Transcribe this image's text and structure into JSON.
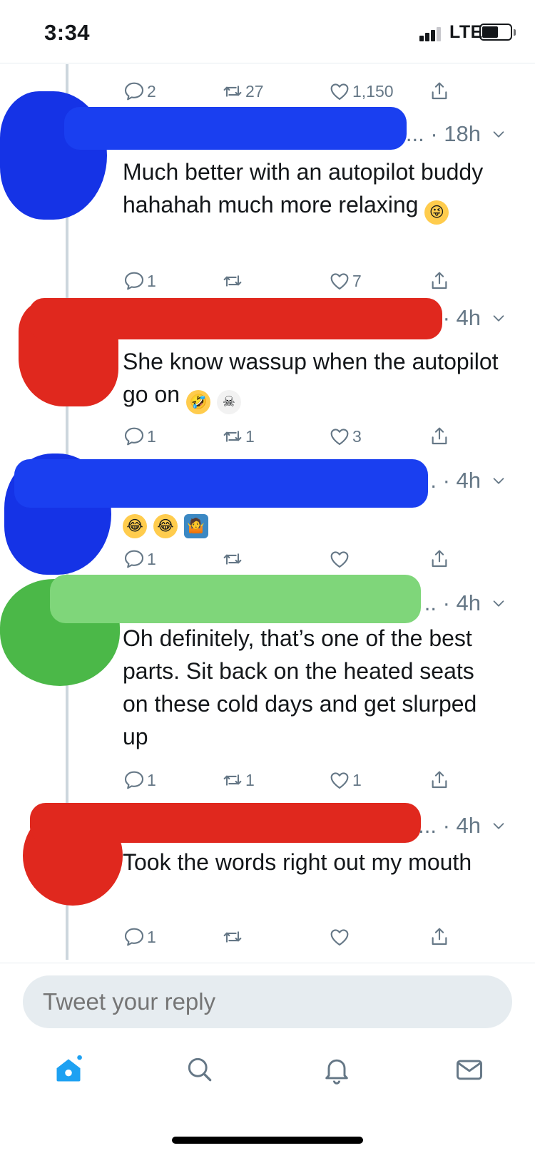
{
  "status_bar": {
    "time": "3:34",
    "network": "LTE"
  },
  "first_tweet_actions": {
    "replies": "2",
    "retweets": "27",
    "likes": "1,150"
  },
  "replies": [
    {
      "meta": "... · 18h",
      "text": "Much better with an autopilot buddy hahahah much more relaxing",
      "emojis": [
        "winking-tongue-face"
      ],
      "actions": {
        "replies": "1",
        "retweets": "",
        "likes": "7"
      },
      "redaction_color": "#1a3ff0"
    },
    {
      "meta": "· 4h",
      "text": "She know wassup when the autopilot go on",
      "emojis": [
        "rolling-laughing-face",
        "skull-crossbones"
      ],
      "actions": {
        "replies": "1",
        "retweets": "1",
        "likes": "3"
      },
      "redaction_color": "#e0281e"
    },
    {
      "meta": ". · 4h",
      "text": "",
      "emojis": [
        "tears-of-joy-face",
        "tears-of-joy-face",
        "man-shrugging"
      ],
      "actions": {
        "replies": "1",
        "retweets": "",
        "likes": ""
      },
      "redaction_color": "#1a3ff0"
    },
    {
      "meta": ".. · 4h",
      "text": "Oh definitely, that’s one of the best parts. Sit back on the heated seats on these cold days and get slurped up",
      "emojis": [],
      "actions": {
        "replies": "1",
        "retweets": "1",
        "likes": "1"
      },
      "redaction_color": "#5cc85a"
    },
    {
      "meta": "... · 4h",
      "text": "Took the words right out my mouth",
      "emojis": [],
      "actions": {
        "replies": "1",
        "retweets": "",
        "likes": ""
      },
      "redaction_color": "#e0281e"
    }
  ],
  "compose": {
    "placeholder": "Tweet your reply"
  },
  "tabbar": {
    "items": [
      {
        "icon": "home-icon",
        "active": true
      },
      {
        "icon": "search-icon",
        "active": false
      },
      {
        "icon": "bell-icon",
        "active": false
      },
      {
        "icon": "mail-icon",
        "active": false
      }
    ]
  },
  "colors": {
    "accent": "#1da1f2",
    "muted": "#657786",
    "divider": "#e6ecf0"
  }
}
